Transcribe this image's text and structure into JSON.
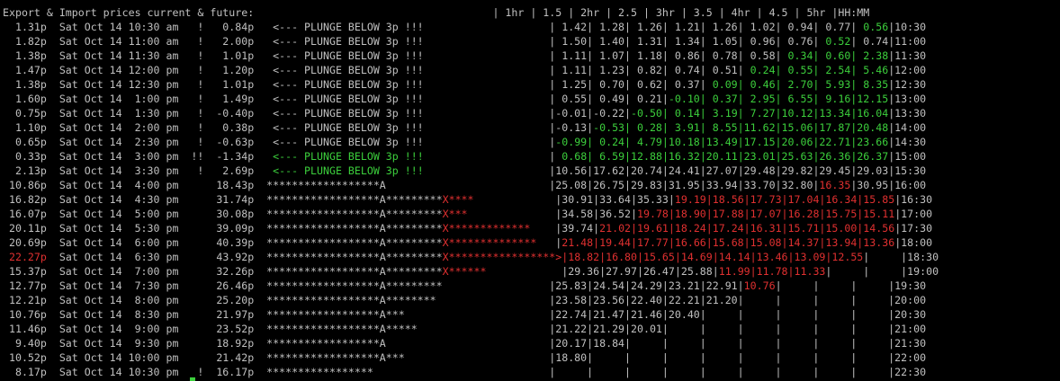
{
  "colors": {
    "background": "#000000",
    "text": "#c0c0c0",
    "green": "#3ccf3c",
    "red": "#e03030",
    "cursor": "#3ccf3c"
  },
  "terminal": {
    "lines": [
      [
        {
          "t": "Export & Import prices current & future:",
          "c": "text"
        },
        {
          "t": "                                      | 1hr | 1.5 | 2hr | 2.5 | 3hr | 3.5 | 4hr | 4.5 | 5hr |HH:MM",
          "c": "text"
        }
      ],
      [
        {
          "t": "  1.31p  Sat Oct 14 10:30 am   !   0.84p   <--- PLUNGE BELOW 3p !!!                    | 1.42| 1.28| 1.26| 1.21| 1.26| 1.02| 0.94| 0.77|",
          "c": "text"
        },
        {
          "t": " 0.56",
          "c": "green"
        },
        {
          "t": "|10:30",
          "c": "text"
        }
      ],
      [
        {
          "t": "  1.82p  Sat Oct 14 11:00 am   !   2.00p   <--- PLUNGE BELOW 3p !!!                    | 1.50| 1.40| 1.31| 1.34| 1.05| 0.96| 0.76|",
          "c": "text"
        },
        {
          "t": " 0.52",
          "c": "green"
        },
        {
          "t": "| 0.74|11:00",
          "c": "text"
        }
      ],
      [
        {
          "t": "  1.38p  Sat Oct 14 11:30 am   !   1.01p   <--- PLUNGE BELOW 3p !!!                    | 1.11| 1.07| 1.18| 0.86| 0.78| 0.58|",
          "c": "text"
        },
        {
          "t": " 0.34| 0.60| 2.38",
          "c": "green"
        },
        {
          "t": "|11:30",
          "c": "text"
        }
      ],
      [
        {
          "t": "  1.47p  Sat Oct 14 12:00 pm   !   1.20p   <--- PLUNGE BELOW 3p !!!                    | 1.11| 1.23| 0.82| 0.74| 0.51|",
          "c": "text"
        },
        {
          "t": " 0.24| 0.55| 2.54| 5.46",
          "c": "green"
        },
        {
          "t": "|12:00",
          "c": "text"
        }
      ],
      [
        {
          "t": "  1.38p  Sat Oct 14 12:30 pm   !   1.01p   <--- PLUNGE BELOW 3p !!!                    | 1.25| 0.70| 0.62| 0.37|",
          "c": "text"
        },
        {
          "t": " 0.09| 0.46| 2.70| 5.93| 8.35",
          "c": "green"
        },
        {
          "t": "|12:30",
          "c": "text"
        }
      ],
      [
        {
          "t": "  1.60p  Sat Oct 14  1:00 pm   !   1.49p   <--- PLUNGE BELOW 3p !!!                    | 0.55| 0.49| 0.21|",
          "c": "text"
        },
        {
          "t": "-0.10| 0.37| 2.95| 6.55| 9.16|12.15",
          "c": "green"
        },
        {
          "t": "|13:00",
          "c": "text"
        }
      ],
      [
        {
          "t": "  0.75p  Sat Oct 14  1:30 pm   !  -0.40p   <--- PLUNGE BELOW 3p !!!                    |-0.01|-0.22|",
          "c": "text"
        },
        {
          "t": "-0.50| 0.14| 3.19| 7.27|10.12|13.34|16.04",
          "c": "green"
        },
        {
          "t": "|13:30",
          "c": "text"
        }
      ],
      [
        {
          "t": "  1.10p  Sat Oct 14  2:00 pm   !   0.38p   <--- PLUNGE BELOW 3p !!!                    |-0.13|",
          "c": "text"
        },
        {
          "t": "-0.53| 0.28| 3.91| 8.55|11.62|15.06|17.87|20.48",
          "c": "green"
        },
        {
          "t": "|14:00",
          "c": "text"
        }
      ],
      [
        {
          "t": "  0.65p  Sat Oct 14  2:30 pm   !  -0.63p   <--- PLUNGE BELOW 3p !!!                    |",
          "c": "text"
        },
        {
          "t": "-0.99| 0.24| 4.79|10.18|13.49|17.15|20.06|22.71|23.66",
          "c": "green"
        },
        {
          "t": "|14:30",
          "c": "text"
        }
      ],
      [
        {
          "t": "  0.33p  Sat Oct 14  3:00 pm  !!  -1.34p   ",
          "c": "text"
        },
        {
          "t": "<--- PLUNGE BELOW 3p !!!",
          "c": "green"
        },
        {
          "t": "                    |",
          "c": "text"
        },
        {
          "t": " 0.68| 6.59|12.88|16.32|20.11|23.01|25.63|26.36|26.37",
          "c": "green"
        },
        {
          "t": "|15:00",
          "c": "text"
        }
      ],
      [
        {
          "t": "  2.13p  Sat Oct 14  3:30 pm   !   2.69p   ",
          "c": "text"
        },
        {
          "t": "<--- PLUNGE BELOW 3p !!!",
          "c": "green"
        },
        {
          "t": "                    |10.56|17.62|20.74|24.41|27.07|29.48|29.82|29.45|29.03|15:30",
          "c": "text"
        }
      ],
      [
        {
          "t": " 10.86p  Sat Oct 14  4:00 pm      18.43p  ******************A                          |25.08|26.75|29.83|31.95|33.94|33.70|32.80|",
          "c": "text"
        },
        {
          "t": "16.35",
          "c": "red"
        },
        {
          "t": "|30.95|16:00",
          "c": "text"
        }
      ],
      [
        {
          "t": " 16.82p  Sat Oct 14  4:30 pm      31.74p  ******************A*********",
          "c": "text"
        },
        {
          "t": "X****",
          "c": "red"
        },
        {
          "t": "             |30.91|33.64|35.33|",
          "c": "text"
        },
        {
          "t": "19.19|18.56|17.73|17.04|16.34|15.85",
          "c": "red"
        },
        {
          "t": "|16:30",
          "c": "text"
        }
      ],
      [
        {
          "t": " 16.07p  Sat Oct 14  5:00 pm      30.08p  ******************A*********",
          "c": "text"
        },
        {
          "t": "X***",
          "c": "red"
        },
        {
          "t": "              |34.58|36.52|",
          "c": "text"
        },
        {
          "t": "19.78|18.90|17.88|17.07|16.28|15.75|15.11",
          "c": "red"
        },
        {
          "t": "|17:00",
          "c": "text"
        }
      ],
      [
        {
          "t": " 20.11p  Sat Oct 14  5:30 pm      39.09p  ******************A*********",
          "c": "text"
        },
        {
          "t": "X*************",
          "c": "red"
        },
        {
          "t": "    |39.74|",
          "c": "text"
        },
        {
          "t": "21.02|19.61|18.24|17.24|16.31|15.71|15.00|14.56",
          "c": "red"
        },
        {
          "t": "|17:30",
          "c": "text"
        }
      ],
      [
        {
          "t": " 20.69p  Sat Oct 14  6:00 pm      40.39p  ******************A*********",
          "c": "text"
        },
        {
          "t": "X**************",
          "c": "red"
        },
        {
          "t": "   |",
          "c": "text"
        },
        {
          "t": "21.48|19.44|17.77|16.66|15.68|15.08|14.37|13.94|13.36",
          "c": "red"
        },
        {
          "t": "|18:00",
          "c": "text"
        }
      ],
      [
        {
          "t": " 22.27p",
          "c": "red"
        },
        {
          "t": "  Sat Oct 14  6:30 pm      43.92p  ******************A*********",
          "c": "text"
        },
        {
          "t": "X*****************>|18.82|16.80|15.65|14.69|14.14|13.46|13.09|12.55",
          "c": "red"
        },
        {
          "t": "|     |18:30",
          "c": "text"
        }
      ],
      [
        {
          "t": " 15.37p  Sat Oct 14  7:00 pm      32.26p  ******************A*********",
          "c": "text"
        },
        {
          "t": "X******",
          "c": "red"
        },
        {
          "t": "            |29.36|27.97|26.47|25.88|",
          "c": "text"
        },
        {
          "t": "11.99|11.78|11.33",
          "c": "red"
        },
        {
          "t": "|     |     |19:00",
          "c": "text"
        }
      ],
      [
        {
          "t": " 12.77p  Sat Oct 14  7:30 pm      26.46p  ******************A*********                 |25.83|24.54|24.29|23.21|22.91|",
          "c": "text"
        },
        {
          "t": "10.76",
          "c": "red"
        },
        {
          "t": "|     |     |     |19:30",
          "c": "text"
        }
      ],
      [
        {
          "t": " 12.21p  Sat Oct 14  8:00 pm      25.20p  ******************A********                  |23.58|23.56|22.40|22.21|21.20|     |     |     |     |20:00",
          "c": "text"
        }
      ],
      [
        {
          "t": " 10.76p  Sat Oct 14  8:30 pm      21.97p  ******************A***                       |22.74|21.47|21.46|20.40|     |     |     |     |     |20:30",
          "c": "text"
        }
      ],
      [
        {
          "t": " 11.46p  Sat Oct 14  9:00 pm      23.52p  ******************A*****                     |21.22|21.29|20.01|     |     |     |     |     |     |21:00",
          "c": "text"
        }
      ],
      [
        {
          "t": "  9.40p  Sat Oct 14  9:30 pm      18.92p  ******************A                          |20.17|18.84|     |     |     |     |     |     |     |21:30",
          "c": "text"
        }
      ],
      [
        {
          "t": " 10.52p  Sat Oct 14 10:00 pm      21.42p  ******************A***                       |18.80|     |     |     |     |     |     |     |     |22:00",
          "c": "text"
        }
      ],
      [
        {
          "t": "  8.17p  Sat Oct 14 10:30 pm   !  16.17p  *****************                            |     |     |     |     |     |     |     |     |     |22:30",
          "c": "text"
        }
      ]
    ]
  }
}
